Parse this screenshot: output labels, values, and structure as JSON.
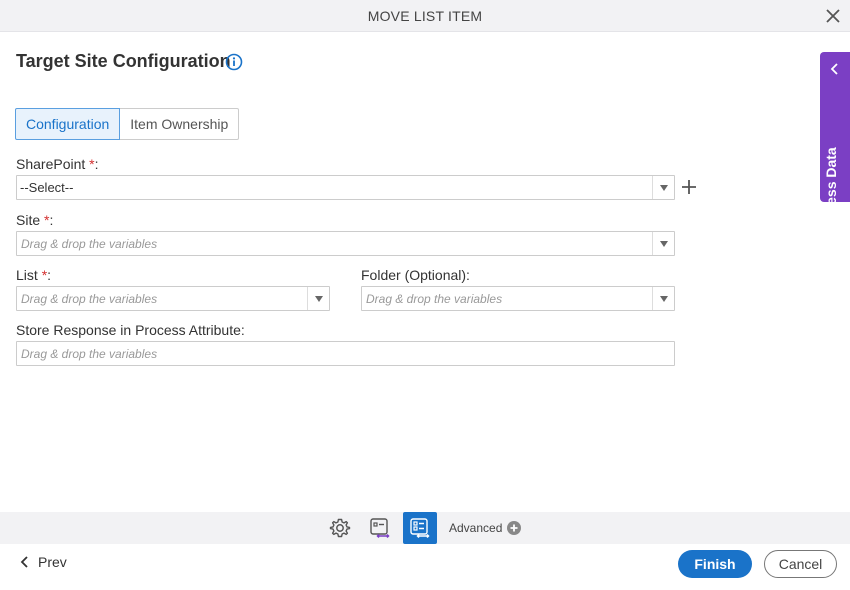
{
  "window": {
    "title": "MOVE LIST ITEM"
  },
  "page": {
    "title": "Target Site Configuration"
  },
  "tabs": [
    {
      "label": "Configuration",
      "active": true
    },
    {
      "label": "Item Ownership",
      "active": false
    }
  ],
  "fields": {
    "sharepoint": {
      "label": "SharePoint",
      "required_mark": "*",
      "colon": ":",
      "value": "--Select--"
    },
    "site": {
      "label": "Site",
      "required_mark": "*",
      "colon": ":",
      "placeholder": "Drag & drop the variables"
    },
    "list": {
      "label": "List",
      "required_mark": "*",
      "colon": ":",
      "placeholder": "Drag & drop the variables"
    },
    "folder": {
      "label": "Folder (Optional):",
      "placeholder": "Drag & drop the variables"
    },
    "store_response": {
      "label": "Store Response in Process Attribute:",
      "placeholder": "Drag & drop the variables"
    }
  },
  "side_panel": {
    "label": "Process Data"
  },
  "toolbar": {
    "advanced_label": "Advanced"
  },
  "footer": {
    "prev_label": "Prev",
    "finish_label": "Finish",
    "cancel_label": "Cancel"
  },
  "colors": {
    "accent": "#1a73c9",
    "side_panel": "#7b3fc4",
    "required": "#d32f2f"
  }
}
